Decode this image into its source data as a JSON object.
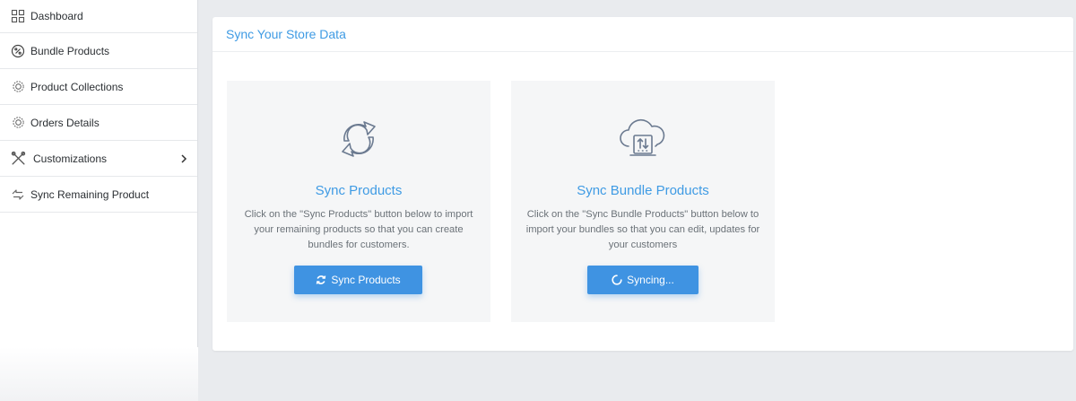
{
  "sidebar": {
    "items": [
      {
        "label": "Dashboard",
        "icon": "grid-icon"
      },
      {
        "label": "Bundle Products",
        "icon": "percent-badge-icon"
      },
      {
        "label": "Product Collections",
        "icon": "gear-badge-icon"
      },
      {
        "label": "Orders Details",
        "icon": "gear-badge-icon"
      },
      {
        "label": "Customizations",
        "icon": "tools-icon",
        "has_submenu": true
      },
      {
        "label": "Sync Remaining Product",
        "icon": "sync-arrows-icon"
      }
    ]
  },
  "card": {
    "title": "Sync Your Store Data"
  },
  "panels": [
    {
      "icon": "sync-circle-icon",
      "title": "Sync Products",
      "description": "Click on the \"Sync Products\" button below to import your remaining products so that you can create bundles for customers.",
      "button_label": "Sync Products",
      "button_icon": "refresh-icon"
    },
    {
      "icon": "cloud-sync-icon",
      "title": "Sync Bundle Products",
      "description": "Click on the \"Sync Bundle Products\" button below to import your bundles so that you can edit, updates for your customers",
      "button_label": "Syncing...",
      "button_icon": "spinner-icon"
    }
  ],
  "colors": {
    "accent": "#3f9be4",
    "button": "#3f93e2",
    "page_bg": "#e9ebee",
    "panel_bg": "#f5f6f7"
  }
}
